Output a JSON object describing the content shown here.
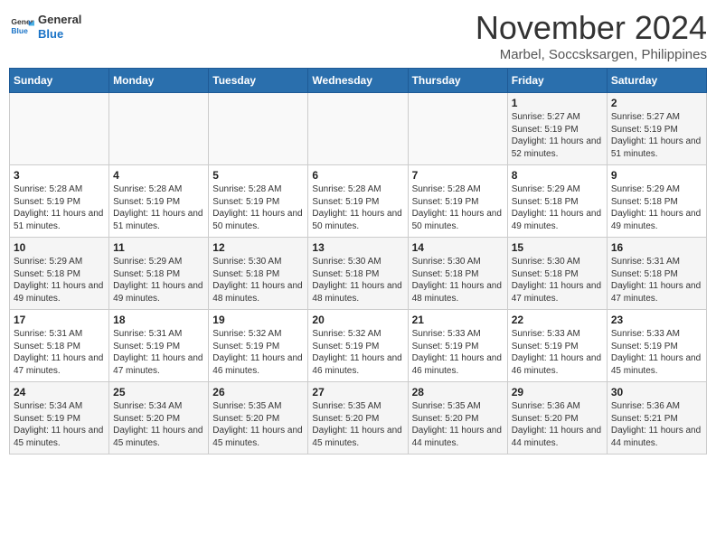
{
  "header": {
    "logo_line1": "General",
    "logo_line2": "Blue",
    "month": "November 2024",
    "location": "Marbel, Soccsksargen, Philippines"
  },
  "weekdays": [
    "Sunday",
    "Monday",
    "Tuesday",
    "Wednesday",
    "Thursday",
    "Friday",
    "Saturday"
  ],
  "weeks": [
    [
      {
        "day": "",
        "info": ""
      },
      {
        "day": "",
        "info": ""
      },
      {
        "day": "",
        "info": ""
      },
      {
        "day": "",
        "info": ""
      },
      {
        "day": "",
        "info": ""
      },
      {
        "day": "1",
        "info": "Sunrise: 5:27 AM\nSunset: 5:19 PM\nDaylight: 11 hours and 52 minutes."
      },
      {
        "day": "2",
        "info": "Sunrise: 5:27 AM\nSunset: 5:19 PM\nDaylight: 11 hours and 51 minutes."
      }
    ],
    [
      {
        "day": "3",
        "info": "Sunrise: 5:28 AM\nSunset: 5:19 PM\nDaylight: 11 hours and 51 minutes."
      },
      {
        "day": "4",
        "info": "Sunrise: 5:28 AM\nSunset: 5:19 PM\nDaylight: 11 hours and 51 minutes."
      },
      {
        "day": "5",
        "info": "Sunrise: 5:28 AM\nSunset: 5:19 PM\nDaylight: 11 hours and 50 minutes."
      },
      {
        "day": "6",
        "info": "Sunrise: 5:28 AM\nSunset: 5:19 PM\nDaylight: 11 hours and 50 minutes."
      },
      {
        "day": "7",
        "info": "Sunrise: 5:28 AM\nSunset: 5:19 PM\nDaylight: 11 hours and 50 minutes."
      },
      {
        "day": "8",
        "info": "Sunrise: 5:29 AM\nSunset: 5:18 PM\nDaylight: 11 hours and 49 minutes."
      },
      {
        "day": "9",
        "info": "Sunrise: 5:29 AM\nSunset: 5:18 PM\nDaylight: 11 hours and 49 minutes."
      }
    ],
    [
      {
        "day": "10",
        "info": "Sunrise: 5:29 AM\nSunset: 5:18 PM\nDaylight: 11 hours and 49 minutes."
      },
      {
        "day": "11",
        "info": "Sunrise: 5:29 AM\nSunset: 5:18 PM\nDaylight: 11 hours and 49 minutes."
      },
      {
        "day": "12",
        "info": "Sunrise: 5:30 AM\nSunset: 5:18 PM\nDaylight: 11 hours and 48 minutes."
      },
      {
        "day": "13",
        "info": "Sunrise: 5:30 AM\nSunset: 5:18 PM\nDaylight: 11 hours and 48 minutes."
      },
      {
        "day": "14",
        "info": "Sunrise: 5:30 AM\nSunset: 5:18 PM\nDaylight: 11 hours and 48 minutes."
      },
      {
        "day": "15",
        "info": "Sunrise: 5:30 AM\nSunset: 5:18 PM\nDaylight: 11 hours and 47 minutes."
      },
      {
        "day": "16",
        "info": "Sunrise: 5:31 AM\nSunset: 5:18 PM\nDaylight: 11 hours and 47 minutes."
      }
    ],
    [
      {
        "day": "17",
        "info": "Sunrise: 5:31 AM\nSunset: 5:18 PM\nDaylight: 11 hours and 47 minutes."
      },
      {
        "day": "18",
        "info": "Sunrise: 5:31 AM\nSunset: 5:19 PM\nDaylight: 11 hours and 47 minutes."
      },
      {
        "day": "19",
        "info": "Sunrise: 5:32 AM\nSunset: 5:19 PM\nDaylight: 11 hours and 46 minutes."
      },
      {
        "day": "20",
        "info": "Sunrise: 5:32 AM\nSunset: 5:19 PM\nDaylight: 11 hours and 46 minutes."
      },
      {
        "day": "21",
        "info": "Sunrise: 5:33 AM\nSunset: 5:19 PM\nDaylight: 11 hours and 46 minutes."
      },
      {
        "day": "22",
        "info": "Sunrise: 5:33 AM\nSunset: 5:19 PM\nDaylight: 11 hours and 46 minutes."
      },
      {
        "day": "23",
        "info": "Sunrise: 5:33 AM\nSunset: 5:19 PM\nDaylight: 11 hours and 45 minutes."
      }
    ],
    [
      {
        "day": "24",
        "info": "Sunrise: 5:34 AM\nSunset: 5:19 PM\nDaylight: 11 hours and 45 minutes."
      },
      {
        "day": "25",
        "info": "Sunrise: 5:34 AM\nSunset: 5:20 PM\nDaylight: 11 hours and 45 minutes."
      },
      {
        "day": "26",
        "info": "Sunrise: 5:35 AM\nSunset: 5:20 PM\nDaylight: 11 hours and 45 minutes."
      },
      {
        "day": "27",
        "info": "Sunrise: 5:35 AM\nSunset: 5:20 PM\nDaylight: 11 hours and 45 minutes."
      },
      {
        "day": "28",
        "info": "Sunrise: 5:35 AM\nSunset: 5:20 PM\nDaylight: 11 hours and 44 minutes."
      },
      {
        "day": "29",
        "info": "Sunrise: 5:36 AM\nSunset: 5:20 PM\nDaylight: 11 hours and 44 minutes."
      },
      {
        "day": "30",
        "info": "Sunrise: 5:36 AM\nSunset: 5:21 PM\nDaylight: 11 hours and 44 minutes."
      }
    ]
  ]
}
